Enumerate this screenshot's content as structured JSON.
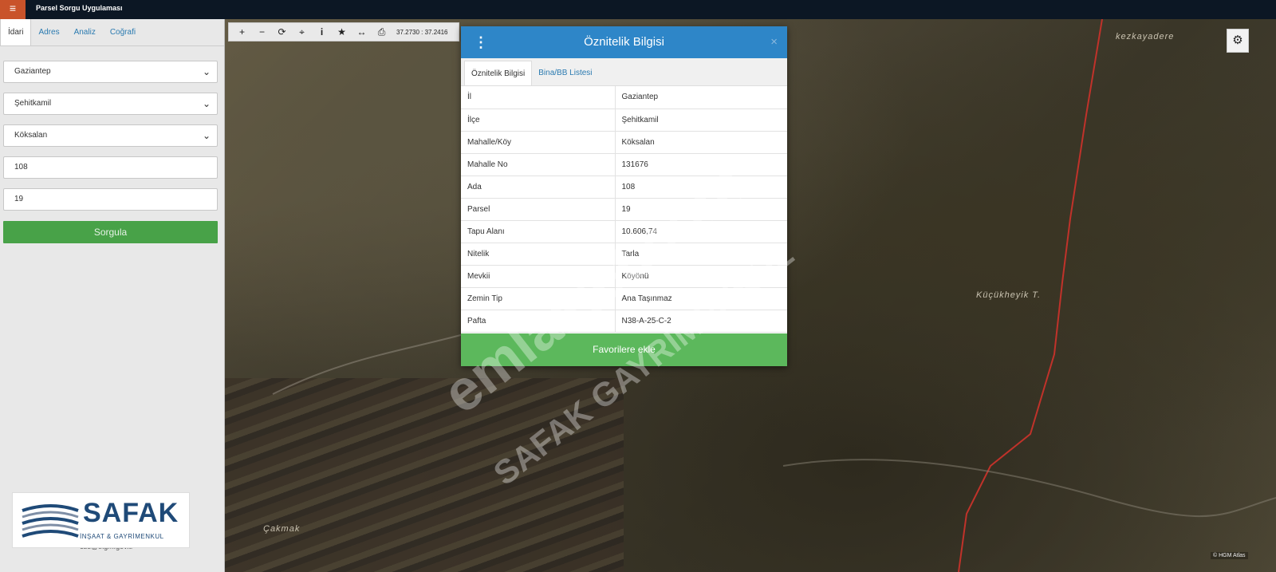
{
  "header": {
    "menu_icon": "hamburger-icon",
    "title": "Parsel Sorgu Uygulaması"
  },
  "sidebar": {
    "tabs": [
      "İdari",
      "Adres",
      "Analiz",
      "Coğrafi"
    ],
    "active_tab": "İdari",
    "il": "Gaziantep",
    "ilce": "Şehitkamil",
    "mahalle": "Köksalan",
    "ada": "108",
    "parsel": "19",
    "query_button": "Sorgula",
    "email": "cbs@tkgm.gov.tr"
  },
  "map": {
    "toolbar": {
      "icons": [
        "zoom-in-icon",
        "zoom-out-icon",
        "refresh-icon",
        "locate-icon",
        "info-icon",
        "star-icon",
        "measure-icon",
        "print-icon"
      ],
      "coordinates": "37.2730 : 37.2416"
    },
    "labels": {
      "top_right": "kezkayadere",
      "right": "Küçükheyik T.",
      "bottom_left": "Çakmak"
    },
    "credits": "© HGM Atlas",
    "gear_icon": "gear-icon"
  },
  "popup": {
    "title": "Öznitelik Bilgisi",
    "tabs": [
      "Öznitelik Bilgisi",
      "Bina/BB Listesi"
    ],
    "rows": [
      {
        "key": "İl",
        "value": "Gaziantep"
      },
      {
        "key": "İlçe",
        "value": "Şehitkamil"
      },
      {
        "key": "Mahalle/Köy",
        "value": "Köksalan"
      },
      {
        "key": "Mahalle No",
        "value": "131676"
      },
      {
        "key": "Ada",
        "value": "108"
      },
      {
        "key": "Parsel",
        "value": "19"
      },
      {
        "key": "Tapu Alanı",
        "value": "10.606,74"
      },
      {
        "key": "Nitelik",
        "value": "Tarla"
      },
      {
        "key": "Mevkii",
        "value": "Köyönü"
      },
      {
        "key": "Zemin Tip",
        "value": "Ana Taşınmaz"
      },
      {
        "key": "Pafta",
        "value": "N38-A-25-C-2"
      }
    ],
    "favorite_button": "Favorilere ekle"
  },
  "logo": {
    "brand": "SAFAK",
    "subtitle": "İNŞAAT & GAYRİMENKUL"
  },
  "watermark": {
    "site": "emlakjet.com",
    "brand": "SAFAK GAYRİMENKUL"
  }
}
